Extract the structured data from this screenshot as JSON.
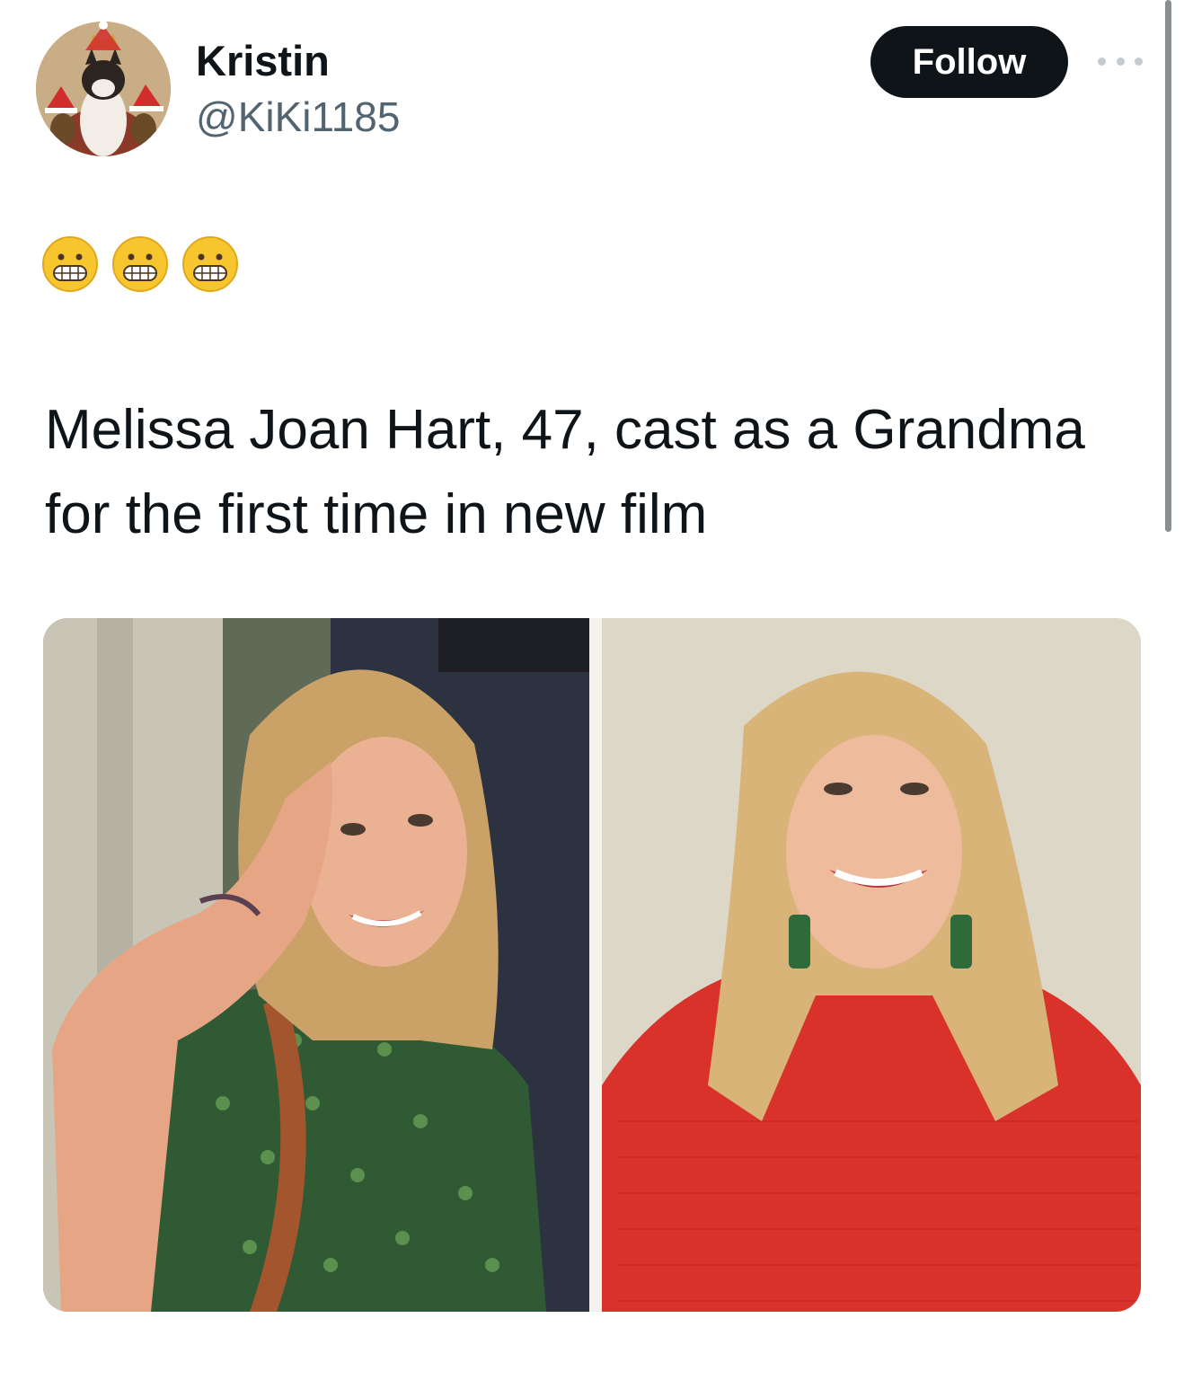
{
  "author": {
    "display_name": "Kristin",
    "handle": "@KiKi1185",
    "avatar_icon": "cat-king-santa-hat-avatar"
  },
  "actions": {
    "follow_label": "Follow",
    "more_icon": "more-horizontal-icon"
  },
  "tweet": {
    "emoji_line": [
      "😬",
      "😬",
      "😬"
    ],
    "text": "Melissa Joan Hart, 47, cast as a Grandma for the first time in new film"
  },
  "colors": {
    "follow_bg": "#0f1419",
    "handle": "#536471",
    "text": "#0f1419"
  }
}
